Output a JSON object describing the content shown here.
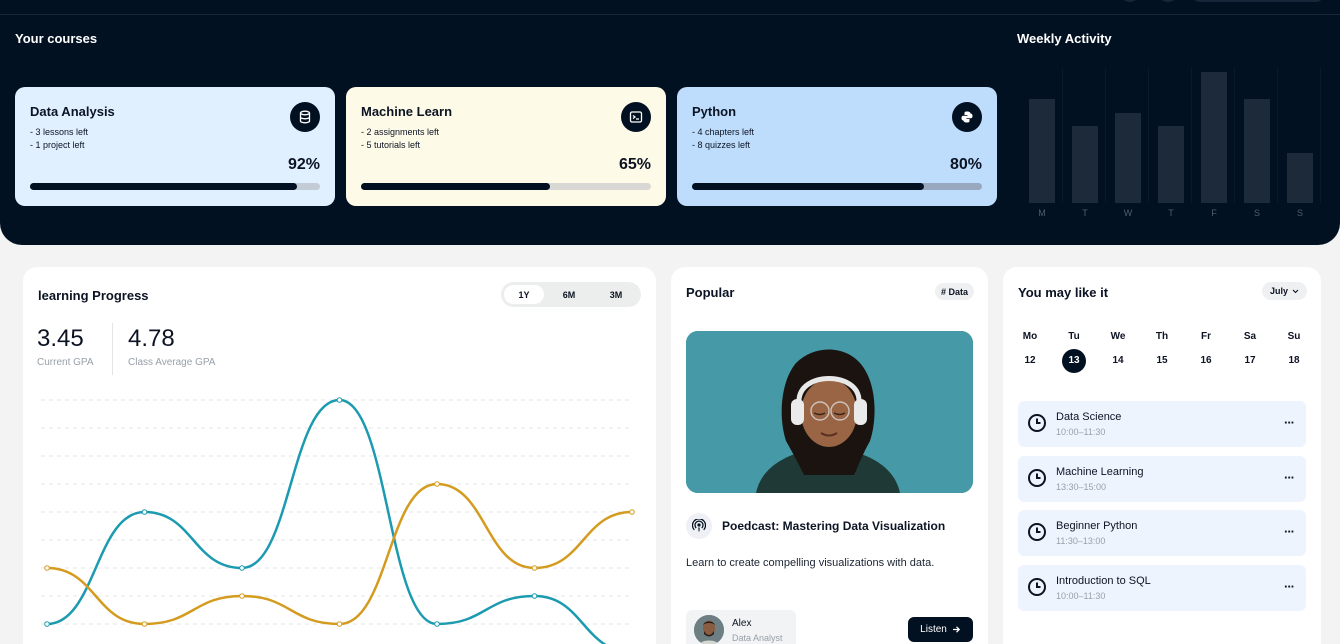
{
  "header": {
    "courses_title": "Your courses",
    "weekly_title": "Weekly Activity"
  },
  "courses": [
    {
      "name": "Data Analysis",
      "lines": [
        "- 3 lessons left",
        "- 1 project left"
      ],
      "percent_label": "92%",
      "progress": 0.92,
      "icon": "database-icon",
      "bg": "#e0f0fe",
      "track": "#c3cbd6"
    },
    {
      "name": "Machine Learn",
      "lines": [
        "- 2 assignments left",
        "- 5 tutorials left"
      ],
      "percent_label": "65%",
      "progress": 0.65,
      "icon": "terminal-icon",
      "bg": "#fefae8",
      "track": "#d9d8d4"
    },
    {
      "name": "Python",
      "lines": [
        "- 4 chapters left",
        "- 8 quizzes left"
      ],
      "percent_label": "80%",
      "progress": 0.8,
      "icon": "python-icon",
      "bg": "#bedcfb",
      "track": "#98a9bf"
    }
  ],
  "weekly_activity": {
    "days": [
      "M",
      "T",
      "W",
      "T",
      "F",
      "S",
      "S"
    ],
    "levels": [
      0.77,
      0.57,
      0.67,
      0.57,
      0.97,
      0.77,
      0.37
    ]
  },
  "learning_progress": {
    "title": "learning Progress",
    "ranges": [
      "1Y",
      "6M",
      "3M"
    ],
    "active_range": "1Y",
    "current_gpa": "3.45",
    "current_gpa_label": "Current GPA",
    "class_avg": "4.78",
    "class_avg_label": "Class Average GPA",
    "colors": {
      "current": "#1b9ab0",
      "average": "#d49b1f"
    }
  },
  "chart_data": {
    "type": "line",
    "series": [
      {
        "values": [
          0,
          4,
          2,
          8,
          0,
          1,
          -1
        ]
      },
      {
        "values": [
          2,
          0,
          1,
          0,
          5,
          2,
          4
        ]
      }
    ]
  },
  "popular": {
    "title": "Popular",
    "tag": "# Data",
    "podcast_title": "Poedcast: Mastering Data Visualization",
    "description": "Learn to create compelling visualizations with data.",
    "author_name": "Alex",
    "author_role": "Data Analyst",
    "listen_label": "Listen"
  },
  "may_like": {
    "title": "You may like it",
    "month": "July",
    "days": [
      {
        "dow": "Mo",
        "num": "12"
      },
      {
        "dow": "Tu",
        "num": "13"
      },
      {
        "dow": "We",
        "num": "14"
      },
      {
        "dow": "Th",
        "num": "15"
      },
      {
        "dow": "Fr",
        "num": "16"
      },
      {
        "dow": "Sa",
        "num": "17"
      },
      {
        "dow": "Su",
        "num": "18"
      }
    ],
    "selected_day": "13",
    "events": [
      {
        "title": "Data Science",
        "time": "10:00–11:30"
      },
      {
        "title": "Machine Learning",
        "time": "13:30–15:00"
      },
      {
        "title": "Beginner Python",
        "time": "11:30–13:00"
      },
      {
        "title": "Introduction to SQL",
        "time": "10:00–11:30"
      }
    ]
  }
}
